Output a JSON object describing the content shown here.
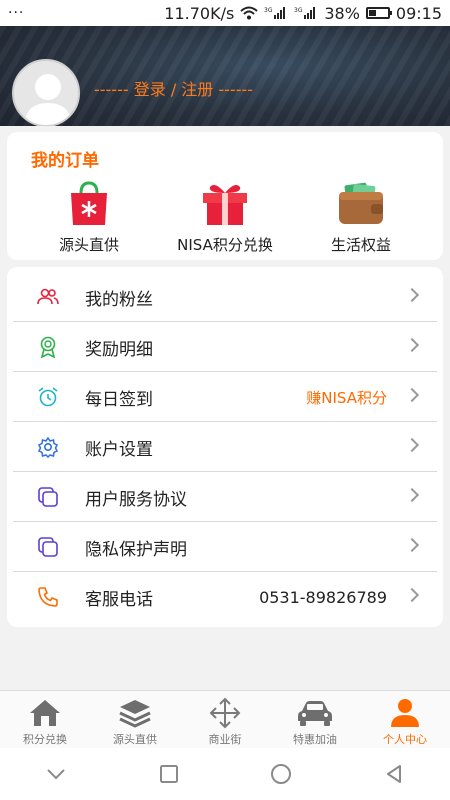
{
  "status_bar": {
    "dots": "···",
    "speed": "11.70K/s",
    "battery": "38%",
    "battery_level": 0.38,
    "time": "09:15"
  },
  "header": {
    "login_text": "------ 登录 / 注册 ------"
  },
  "orders": {
    "title": "我的订单",
    "items": [
      {
        "label": "源头直供",
        "icon": "shopping-bag-icon"
      },
      {
        "label": "NISA积分兑换",
        "icon": "gift-box-icon"
      },
      {
        "label": "生活权益",
        "icon": "wallet-icon"
      }
    ]
  },
  "menu": {
    "items": [
      {
        "label": "我的粉丝",
        "value": "",
        "icon": "fans-icon"
      },
      {
        "label": "奖励明细",
        "value": "",
        "icon": "award-icon"
      },
      {
        "label": "每日签到",
        "value": "赚NISA积分",
        "icon": "alarm-clock-icon"
      },
      {
        "label": "账户设置",
        "value": "",
        "icon": "gear-icon"
      },
      {
        "label": "用户服务协议",
        "value": "",
        "icon": "document-icon"
      },
      {
        "label": "隐私保护声明",
        "value": "",
        "icon": "document-icon"
      },
      {
        "label": "客服电话",
        "value": "0531-89826789",
        "icon": "phone-icon"
      }
    ]
  },
  "tabbar": {
    "tabs": [
      {
        "label": "积分兑换",
        "icon": "home-icon",
        "active": false
      },
      {
        "label": "源头直供",
        "icon": "layers-icon",
        "active": false
      },
      {
        "label": "商业街",
        "icon": "move-arrows-icon",
        "active": false
      },
      {
        "label": "特惠加油",
        "icon": "car-icon",
        "active": false
      },
      {
        "label": "个人中心",
        "icon": "person-icon",
        "active": true
      }
    ]
  },
  "colors": {
    "accent": "#ff6a00",
    "header_bg": "#2a3340",
    "card_bg": "#ffffff",
    "page_bg": "#f2f2f2"
  }
}
